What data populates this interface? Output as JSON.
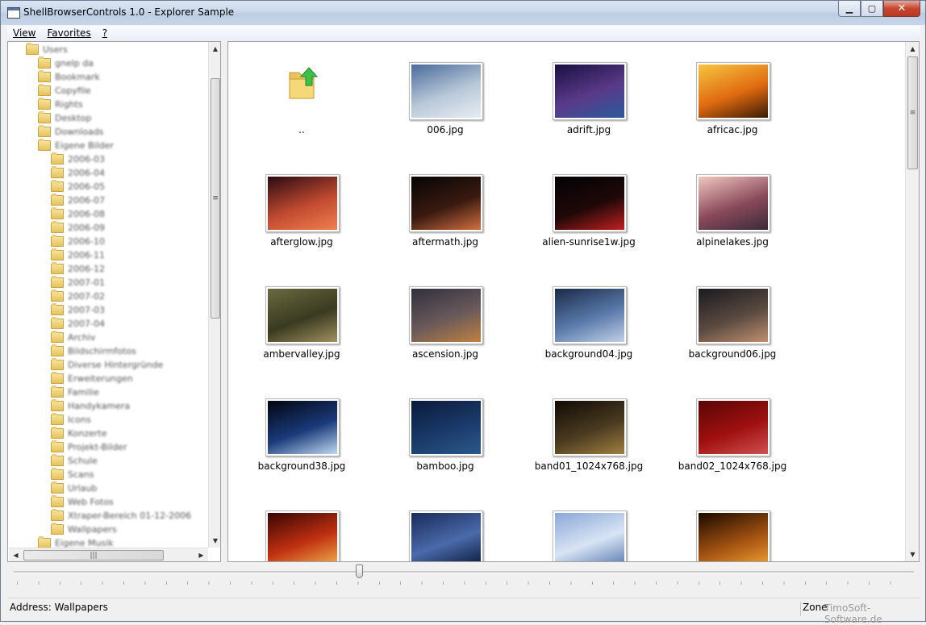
{
  "window": {
    "title": "ShellBrowserControls 1.0 - Explorer Sample"
  },
  "caption_buttons": {
    "minimize": "▁",
    "maximize": "▢",
    "close": "✕"
  },
  "menu": [
    {
      "label": "View"
    },
    {
      "label": "Favorites"
    },
    {
      "label": "?"
    }
  ],
  "tree": {
    "nodes": [
      {
        "label": "Users"
      },
      {
        "label": "gnelp da"
      },
      {
        "label": "Bookmark"
      },
      {
        "label": "Copyfile"
      },
      {
        "label": "Rights"
      },
      {
        "label": "Desktop"
      },
      {
        "label": "Downloads"
      },
      {
        "label": "Eigene Bilder"
      },
      {
        "label": "2006-03"
      },
      {
        "label": "2006-04"
      },
      {
        "label": "2006-05"
      },
      {
        "label": "2006-07"
      },
      {
        "label": "2006-08"
      },
      {
        "label": "2006-09"
      },
      {
        "label": "2006-10"
      },
      {
        "label": "2006-11"
      },
      {
        "label": "2006-12"
      },
      {
        "label": "2007-01"
      },
      {
        "label": "2007-02"
      },
      {
        "label": "2007-03"
      },
      {
        "label": "2007-04"
      },
      {
        "label": "Archiv"
      },
      {
        "label": "Bildschirmfotos"
      },
      {
        "label": "Diverse Hintergründe"
      },
      {
        "label": "Erweiterungen"
      },
      {
        "label": "Familie"
      },
      {
        "label": "Handykamera"
      },
      {
        "label": "Icons"
      },
      {
        "label": "Konzerte"
      },
      {
        "label": "Projekt-Bilder"
      },
      {
        "label": "Schule"
      },
      {
        "label": "Scans"
      },
      {
        "label": "Urlaub"
      },
      {
        "label": "Web Fotos"
      },
      {
        "label": "Xtraper-Bereich 01-12-2006"
      },
      {
        "label": "Wallpapers"
      },
      {
        "label": "Eigene Musik"
      }
    ]
  },
  "files": [
    {
      "name": "..",
      "kind": "up"
    },
    {
      "name": "006.jpg",
      "kind": "image",
      "colors": [
        "#4a6a9a",
        "#b8c8d8",
        "#e6edf3"
      ]
    },
    {
      "name": "adrift.jpg",
      "kind": "image",
      "colors": [
        "#1a1040",
        "#5a3a8a",
        "#2a5a9a"
      ]
    },
    {
      "name": "africac.jpg",
      "kind": "image",
      "colors": [
        "#f7c540",
        "#e06a10",
        "#3a1a05"
      ]
    },
    {
      "name": "afterglow.jpg",
      "kind": "image",
      "colors": [
        "#2a0a12",
        "#c04a30",
        "#f08050"
      ]
    },
    {
      "name": "aftermath.jpg",
      "kind": "image",
      "colors": [
        "#050505",
        "#3a1a10",
        "#d07040"
      ]
    },
    {
      "name": "alien-sunrise1w.jpg",
      "kind": "image",
      "colors": [
        "#020205",
        "#200808",
        "#c02020"
      ]
    },
    {
      "name": "alpinelakes.jpg",
      "kind": "image",
      "colors": [
        "#f0c8c0",
        "#8a4a5a",
        "#3a2a3a"
      ]
    },
    {
      "name": "ambervalley.jpg",
      "kind": "image",
      "colors": [
        "#6a6a40",
        "#3a3a20",
        "#a09060"
      ]
    },
    {
      "name": "ascension.jpg",
      "kind": "image",
      "colors": [
        "#303040",
        "#6a5a5a",
        "#c08040"
      ]
    },
    {
      "name": "background04.jpg",
      "kind": "image",
      "colors": [
        "#1a2a4a",
        "#5a7aaa",
        "#c0d0e8"
      ]
    },
    {
      "name": "background06.jpg",
      "kind": "image",
      "colors": [
        "#1a1a20",
        "#5a4a40",
        "#c09070"
      ]
    },
    {
      "name": "background38.jpg",
      "kind": "image",
      "colors": [
        "#020510",
        "#1a3a7a",
        "#bfd8f0"
      ]
    },
    {
      "name": "bamboo.jpg",
      "kind": "image",
      "colors": [
        "#0a1a3a",
        "#1a3a6a",
        "#2a5a8a"
      ]
    },
    {
      "name": "band01_1024x768.jpg",
      "kind": "image",
      "colors": [
        "#100a05",
        "#4a3a20",
        "#a08040"
      ]
    },
    {
      "name": "band02_1024x768.jpg",
      "kind": "image",
      "colors": [
        "#5a0505",
        "#a01010",
        "#d05050"
      ]
    },
    {
      "name": "",
      "kind": "image",
      "colors": [
        "#3a0505",
        "#c03010",
        "#f0b050"
      ]
    },
    {
      "name": "",
      "kind": "image",
      "colors": [
        "#1a2a5a",
        "#4a6aaa",
        "#0a1a3a"
      ]
    },
    {
      "name": "",
      "kind": "image",
      "colors": [
        "#8aa8d8",
        "#d8e4f4",
        "#5a7ab0"
      ]
    },
    {
      "name": "",
      "kind": "image",
      "colors": [
        "#1a0a00",
        "#a05010",
        "#f0a030"
      ]
    }
  ],
  "slider": {
    "zoom": 0.38
  },
  "status": {
    "address": "Address: Wallpapers",
    "zone": "Zone",
    "watermark": "TimoSoft-Software.de"
  }
}
